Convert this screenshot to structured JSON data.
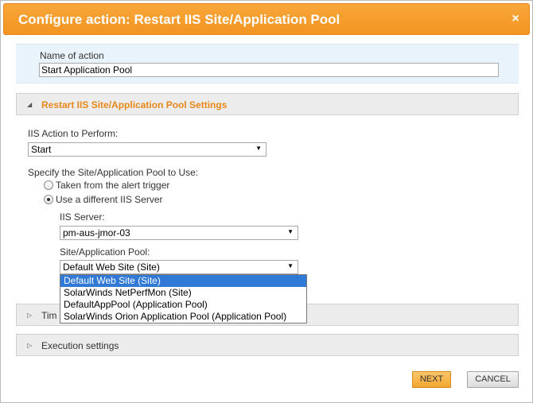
{
  "dialog": {
    "title": "Configure action: Restart IIS Site/Application Pool",
    "close_glyph": "×"
  },
  "name_panel": {
    "label": "Name of action",
    "value": "Start Application Pool"
  },
  "settings_section": {
    "title": "Restart IIS Site/Application Pool Settings",
    "expanded": true,
    "action_label": "IIS Action to Perform:",
    "action_value": "Start",
    "pool_label": "Specify the Site/Application Pool to Use:",
    "radio_options": [
      {
        "label": "Taken from the alert trigger",
        "checked": false
      },
      {
        "label": "Use a different IIS Server",
        "checked": true
      }
    ],
    "server_label": "IIS Server:",
    "server_value": "pm-aus-jmor-03",
    "site_label": "Site/Application Pool:",
    "site_value": "Default Web Site (Site)",
    "site_options": [
      "Default Web Site (Site)",
      "SolarWinds NetPerfMon (Site)",
      "DefaultAppPool (Application Pool)",
      "SolarWinds Orion Application Pool (Application Pool)"
    ],
    "site_selected_index": 0
  },
  "timing_section": {
    "title": "Tim"
  },
  "execution_section": {
    "title": "Execution settings"
  },
  "buttons": {
    "next": "NEXT",
    "cancel": "CANCEL"
  },
  "icons": {
    "expanded": "triangle-down-icon",
    "collapsed": "triangle-right-icon",
    "select_arrow": "chevron-down-icon"
  },
  "colors": {
    "title_bar": "#f29422",
    "accent_text": "#e8871a",
    "selection": "#3079d6",
    "name_panel_bg": "#e8f3fb"
  }
}
